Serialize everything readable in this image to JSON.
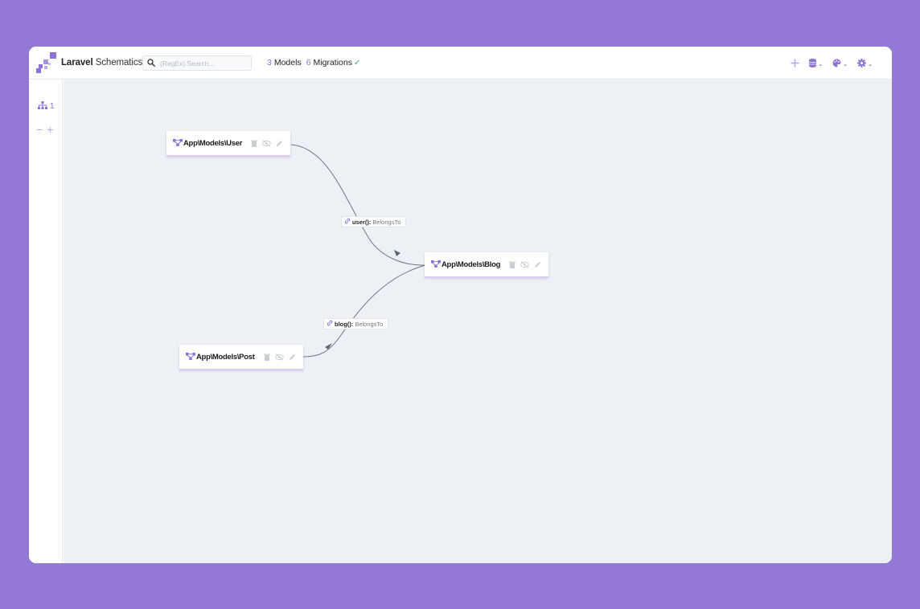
{
  "app": {
    "brand_bold": "Laravel",
    "brand_light": " Schematics"
  },
  "search": {
    "placeholder": "(RegEx) Search...",
    "value": ""
  },
  "stats": {
    "models_count": "3",
    "models_label": "Models",
    "migrations_count": "6",
    "migrations_label": "Migrations",
    "migrations_status": "✓"
  },
  "sidebar": {
    "tree_count": "1",
    "zoom_out": "−",
    "zoom_in": "+"
  },
  "colors": {
    "accent": "#8c72d4",
    "background": "#9478d5",
    "canvas": "#edf1f6",
    "success": "#3aaa6a"
  },
  "icons": {
    "brand": "schematics-logo-icon",
    "search": "search-icon",
    "add": "plus-icon",
    "database": "database-icon",
    "theme": "palette-icon",
    "settings": "gear-icon",
    "model": "model-network-icon",
    "delete": "trash-icon",
    "hide": "eye-slash-icon",
    "edit": "pencil-icon",
    "relation": "link-icon",
    "tree": "sitemap-icon"
  },
  "models": [
    {
      "name": "App\\Models\\User"
    },
    {
      "name": "App\\Models\\Blog"
    },
    {
      "name": "App\\Models\\Post"
    }
  ],
  "relations": [
    {
      "method": "user():",
      "type": "BelongsTo"
    },
    {
      "method": "blog():",
      "type": "BelongsTo"
    }
  ]
}
